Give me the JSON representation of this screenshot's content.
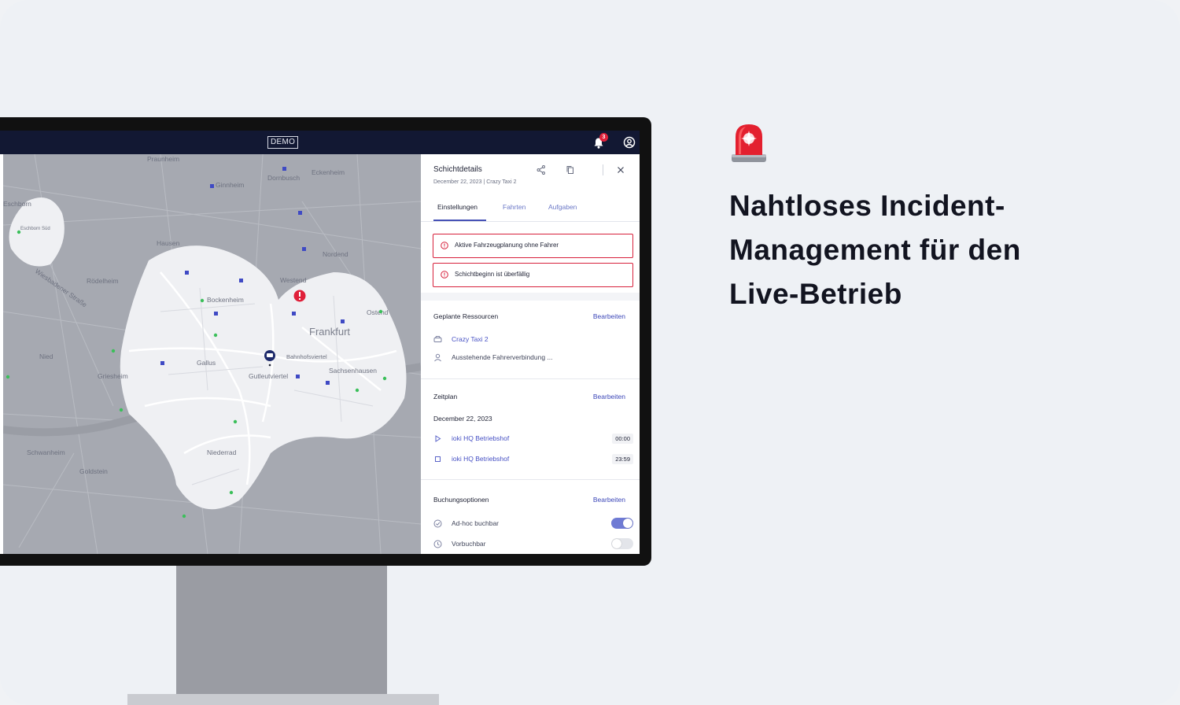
{
  "app": {
    "demo_badge": "DEMO",
    "notification_count": "3"
  },
  "map": {
    "labels": [
      {
        "text": "Praunheim"
      },
      {
        "text": "Eckenheim"
      },
      {
        "text": "Ginnheim"
      },
      {
        "text": "Dornbusch"
      },
      {
        "text": "Eschborn"
      },
      {
        "text": "Eschborn Süd"
      },
      {
        "text": "Hausen"
      },
      {
        "text": "Rödelheim"
      },
      {
        "text": "Bockenheim"
      },
      {
        "text": "Westend"
      },
      {
        "text": "Nordend"
      },
      {
        "text": "Frankfurt"
      },
      {
        "text": "Ostend"
      },
      {
        "text": "Gallus"
      },
      {
        "text": "Griesheim"
      },
      {
        "text": "Nied"
      },
      {
        "text": "Gutleutviertel"
      },
      {
        "text": "Sachsenhausen"
      },
      {
        "text": "Schwanheim"
      },
      {
        "text": "Niederrad"
      },
      {
        "text": "Goldstein"
      },
      {
        "text": "Wiesbadener Straße"
      },
      {
        "text": "Bahnhofsviertel"
      }
    ]
  },
  "panel": {
    "title": "Schichtdetails",
    "subtitle": "December 22, 2023 | Crazy Taxi 2",
    "tabs": [
      "Einstellungen",
      "Fahrten",
      "Aufgaben"
    ],
    "alerts": [
      "Aktive Fahrzeugplanung ohne Fahrer",
      "Schichtbeginn ist überfällig"
    ],
    "resources": {
      "title": "Geplante Ressourcen",
      "edit": "Bearbeiten",
      "vehicle": "Crazy Taxi 2",
      "driver": "Ausstehende Fahrerverbindung ..."
    },
    "schedule": {
      "title": "Zeitplan",
      "edit": "Bearbeiten",
      "date": "December 22, 2023",
      "start_place": "ioki HQ Betriebshof",
      "start_time": "00:00",
      "end_place": "ioki HQ Betriebshof",
      "end_time": "23:59"
    },
    "booking": {
      "title": "Buchungsoptionen",
      "edit": "Bearbeiten",
      "adhoc": "Ad-hoc buchbar",
      "adhoc_on": true,
      "prebook": "Vorbuchbar",
      "prebook_on": false
    }
  },
  "headline": {
    "line1": "Nahtloses Incident-",
    "line2": "Management für den",
    "line3": "Live-Betrieb"
  },
  "colors": {
    "navbar": "#121833",
    "accent": "#4651b6",
    "alert": "#d7213c",
    "toggle_on": "#6f7bd4"
  }
}
